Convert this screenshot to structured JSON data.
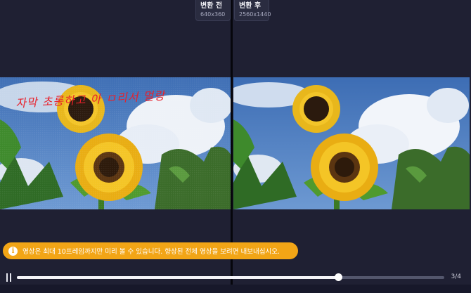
{
  "left_label": {
    "title": "변환 전",
    "resolution": "640x360"
  },
  "right_label": {
    "title": "변환 후",
    "resolution": "2560x1440"
  },
  "watermark_text": "자막 초롱하고 아 ㅁ리서 멀랑",
  "notice": {
    "icon": "info-icon",
    "text": "영상은 최대 10프레임까지만 미리 볼 수 있습니다. 향상된 전체 영상을 보려면 내보내십시오."
  },
  "player": {
    "progress": 0.752,
    "counter": "3/4",
    "play_state_icon": "pause-icon"
  },
  "colors": {
    "background": "#1f2033",
    "notice": "#f2a516",
    "divider": "#06060c"
  }
}
